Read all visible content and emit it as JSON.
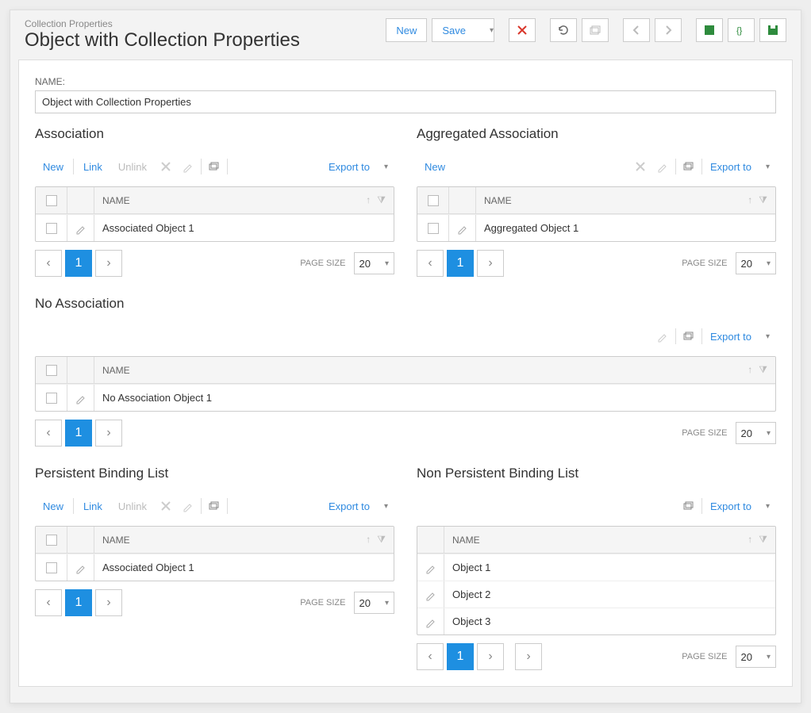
{
  "header": {
    "breadcrumb": "Collection Properties",
    "title": "Object with Collection Properties",
    "new_label": "New",
    "save_label": "Save"
  },
  "name_field": {
    "label": "NAME:",
    "value": "Object with Collection Properties"
  },
  "labels": {
    "name_col": "NAME",
    "page_size": "PAGE SIZE",
    "export": "Export to",
    "new": "New",
    "link": "Link",
    "unlink": "Unlink"
  },
  "page_size_value": "20",
  "page_current": "1",
  "sections": {
    "association": {
      "title": "Association",
      "rows": [
        {
          "name": "Associated Object 1"
        }
      ]
    },
    "aggregated": {
      "title": "Aggregated Association",
      "rows": [
        {
          "name": "Aggregated Object 1"
        }
      ]
    },
    "no_association": {
      "title": "No Association",
      "rows": [
        {
          "name": "No Association Object 1"
        }
      ]
    },
    "persistent": {
      "title": "Persistent Binding List",
      "rows": [
        {
          "name": "Associated Object 1"
        }
      ]
    },
    "non_persistent": {
      "title": "Non Persistent Binding List",
      "rows": [
        {
          "name": "Object 1"
        },
        {
          "name": "Object 2"
        },
        {
          "name": "Object 3"
        }
      ]
    }
  }
}
